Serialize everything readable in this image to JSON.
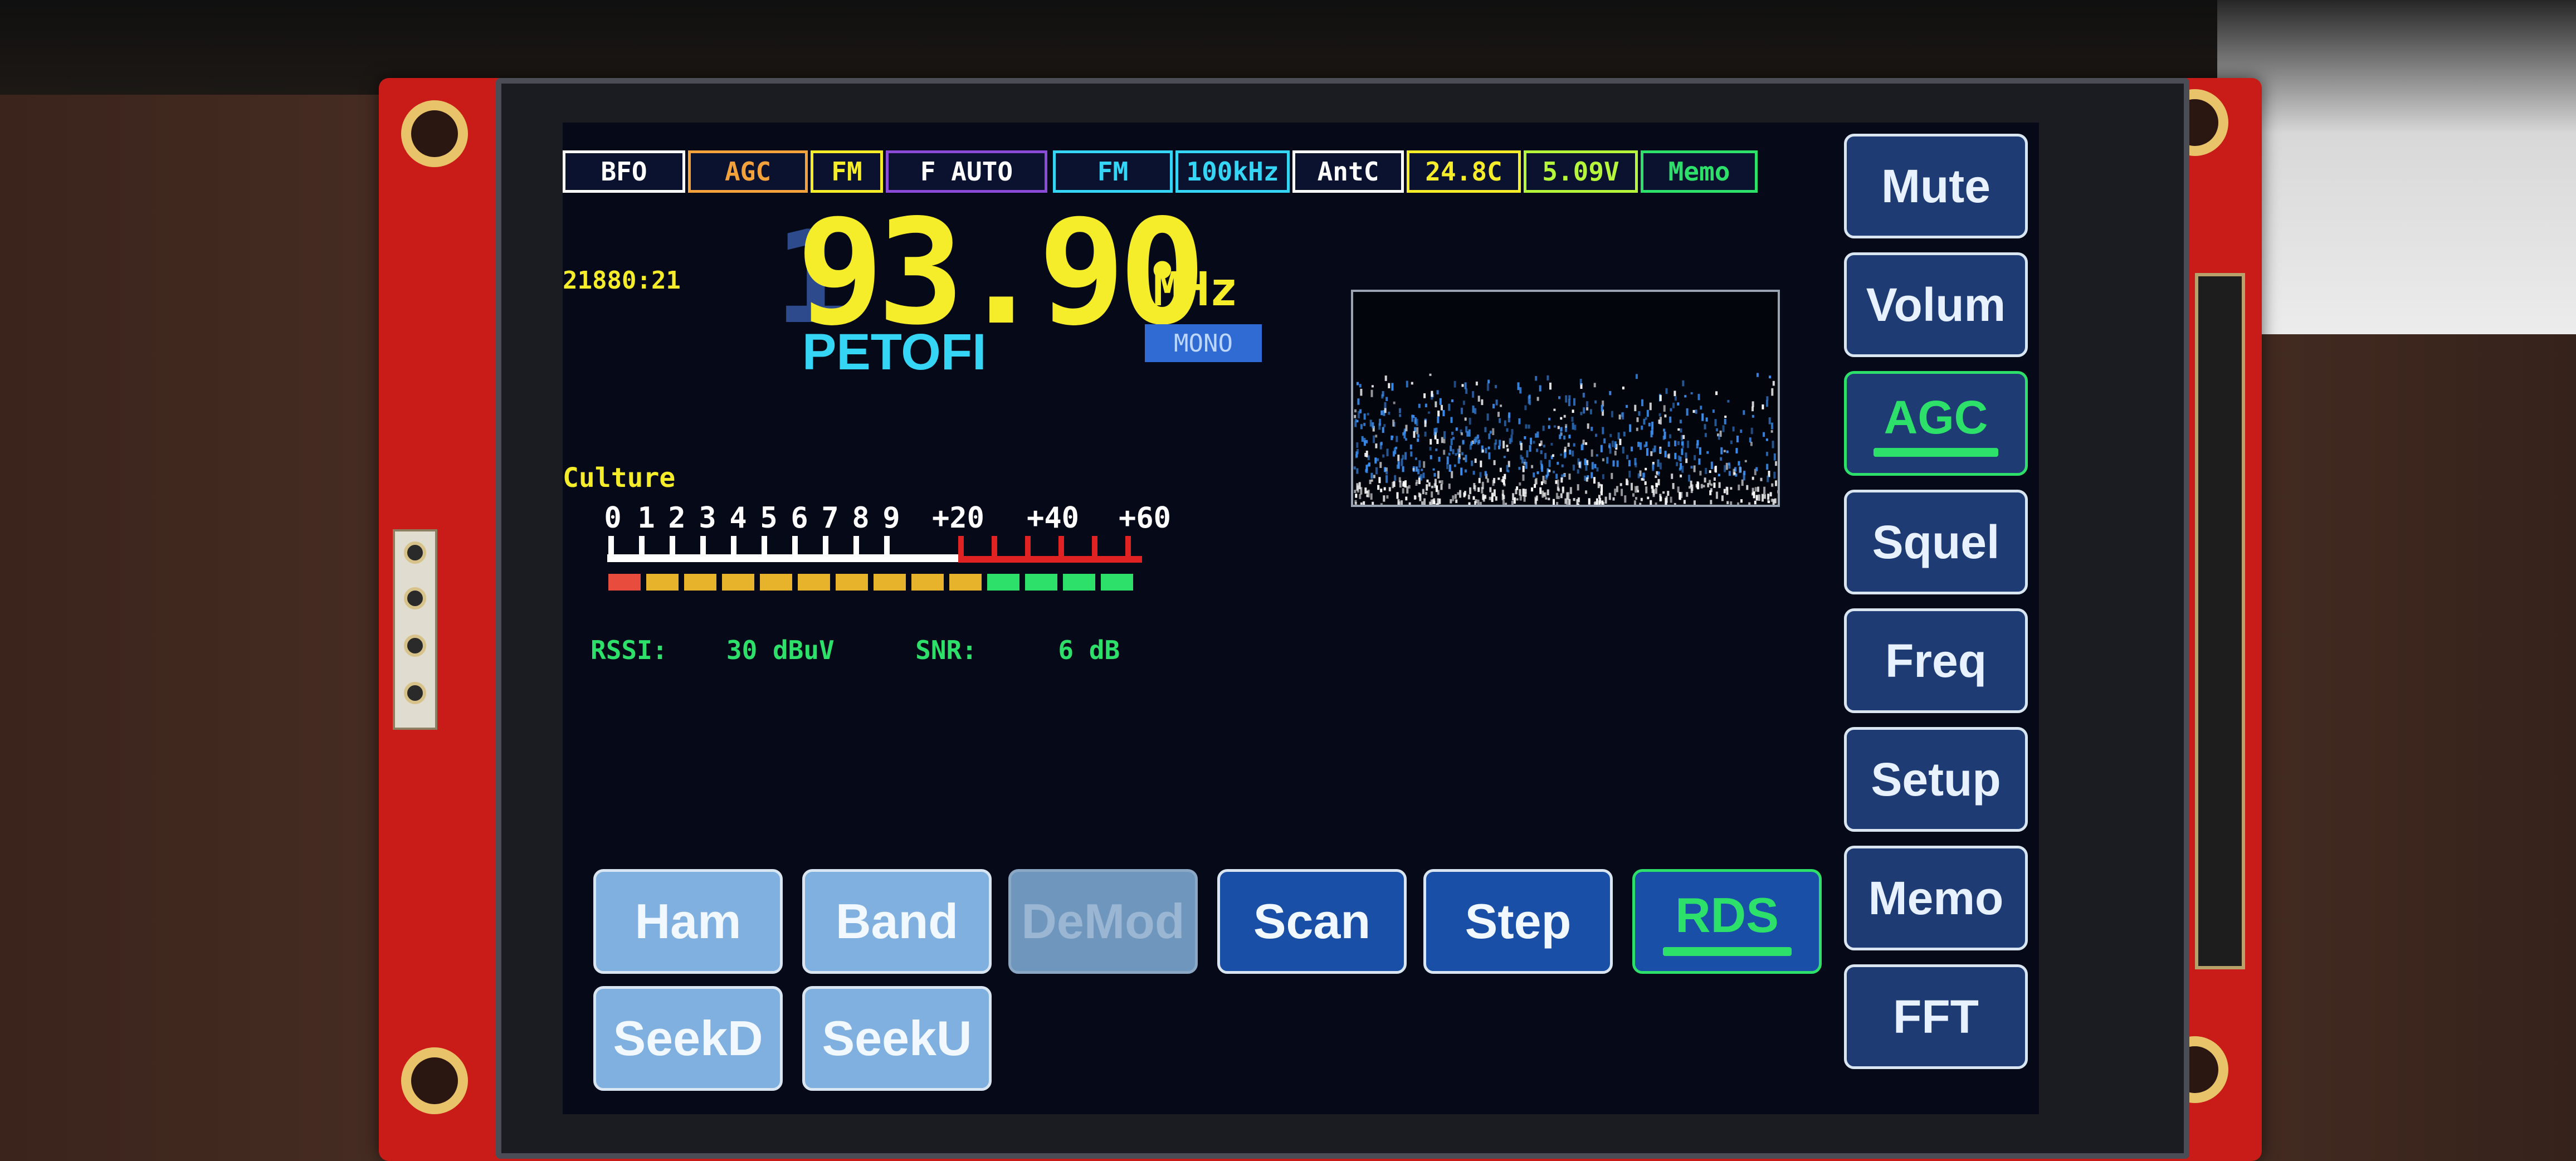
{
  "status_bar": [
    {
      "label": "BFO",
      "color": "#ffffff",
      "border": "#ffffff",
      "bg": "#0a1230"
    },
    {
      "label": "AGC",
      "color": "#f2a13b",
      "border": "#f2a13b",
      "bg": "#0a1230"
    },
    {
      "label": "FM",
      "color": "#f5ec2a",
      "border": "#f5ec2a",
      "bg": "#0a1230"
    },
    {
      "label": "F AUTO",
      "color": "#ffffff",
      "border": "#8a4bd9",
      "bg": "#0a1230"
    },
    {
      "label": "FM",
      "color": "#35d6f5",
      "border": "#35d6f5",
      "bg": "#0a1230"
    },
    {
      "label": "100kHz",
      "color": "#35d6f5",
      "border": "#35d6f5",
      "bg": "#0a1230"
    },
    {
      "label": "AntC",
      "color": "#ffffff",
      "border": "#ffffff",
      "bg": "#0a1230"
    },
    {
      "label": "24.8C",
      "color": "#f5ec2a",
      "border": "#f5ec2a",
      "bg": "#0a1230"
    },
    {
      "label": "5.09V",
      "color": "#b5f53a",
      "border": "#b5f53a",
      "bg": "#0a1230"
    },
    {
      "label": "Memo",
      "color": "#2de06a",
      "border": "#2de06a",
      "bg": "#0a1230"
    }
  ],
  "tuner": {
    "code": "21880:21",
    "frequency": "93.90",
    "frequency_lead": "1",
    "unit": "MHz",
    "station_name": "PETOFI",
    "stereo_mode": "MONO",
    "program_type": "Culture"
  },
  "smeter": {
    "labels": [
      "0",
      "1",
      "2",
      "3",
      "4",
      "5",
      "6",
      "7",
      "8",
      "9",
      "+20",
      "+40",
      "+60"
    ],
    "level_segments": 14,
    "rssi_label": "RSSI:",
    "rssi_value": "30 dBuV",
    "snr_label": "SNR:",
    "snr_value": "6 dB"
  },
  "side_buttons": [
    {
      "label": "Mute",
      "active": false
    },
    {
      "label": "Volum",
      "active": false
    },
    {
      "label": "AGC",
      "active": true
    },
    {
      "label": "Squel",
      "active": false
    },
    {
      "label": "Freq",
      "active": false
    },
    {
      "label": "Setup",
      "active": false
    },
    {
      "label": "Memo",
      "active": false
    },
    {
      "label": "FFT",
      "active": false
    }
  ],
  "bottom_buttons": [
    {
      "label": "Ham",
      "style": "light"
    },
    {
      "label": "Band",
      "style": "light"
    },
    {
      "label": "DeMod",
      "style": "disabled"
    },
    {
      "label": "Scan",
      "style": "dark"
    },
    {
      "label": "Step",
      "style": "dark"
    },
    {
      "label": "RDS",
      "style": "green"
    }
  ],
  "bottom_buttons_row2": [
    {
      "label": "SeekD"
    },
    {
      "label": "SeekU"
    }
  ],
  "colors": {
    "screen_bg": "#060a18",
    "accent_yellow": "#f5ec2a",
    "accent_cyan": "#35d6f5",
    "accent_green": "#2de06a",
    "pcb_red": "#c91b17"
  }
}
